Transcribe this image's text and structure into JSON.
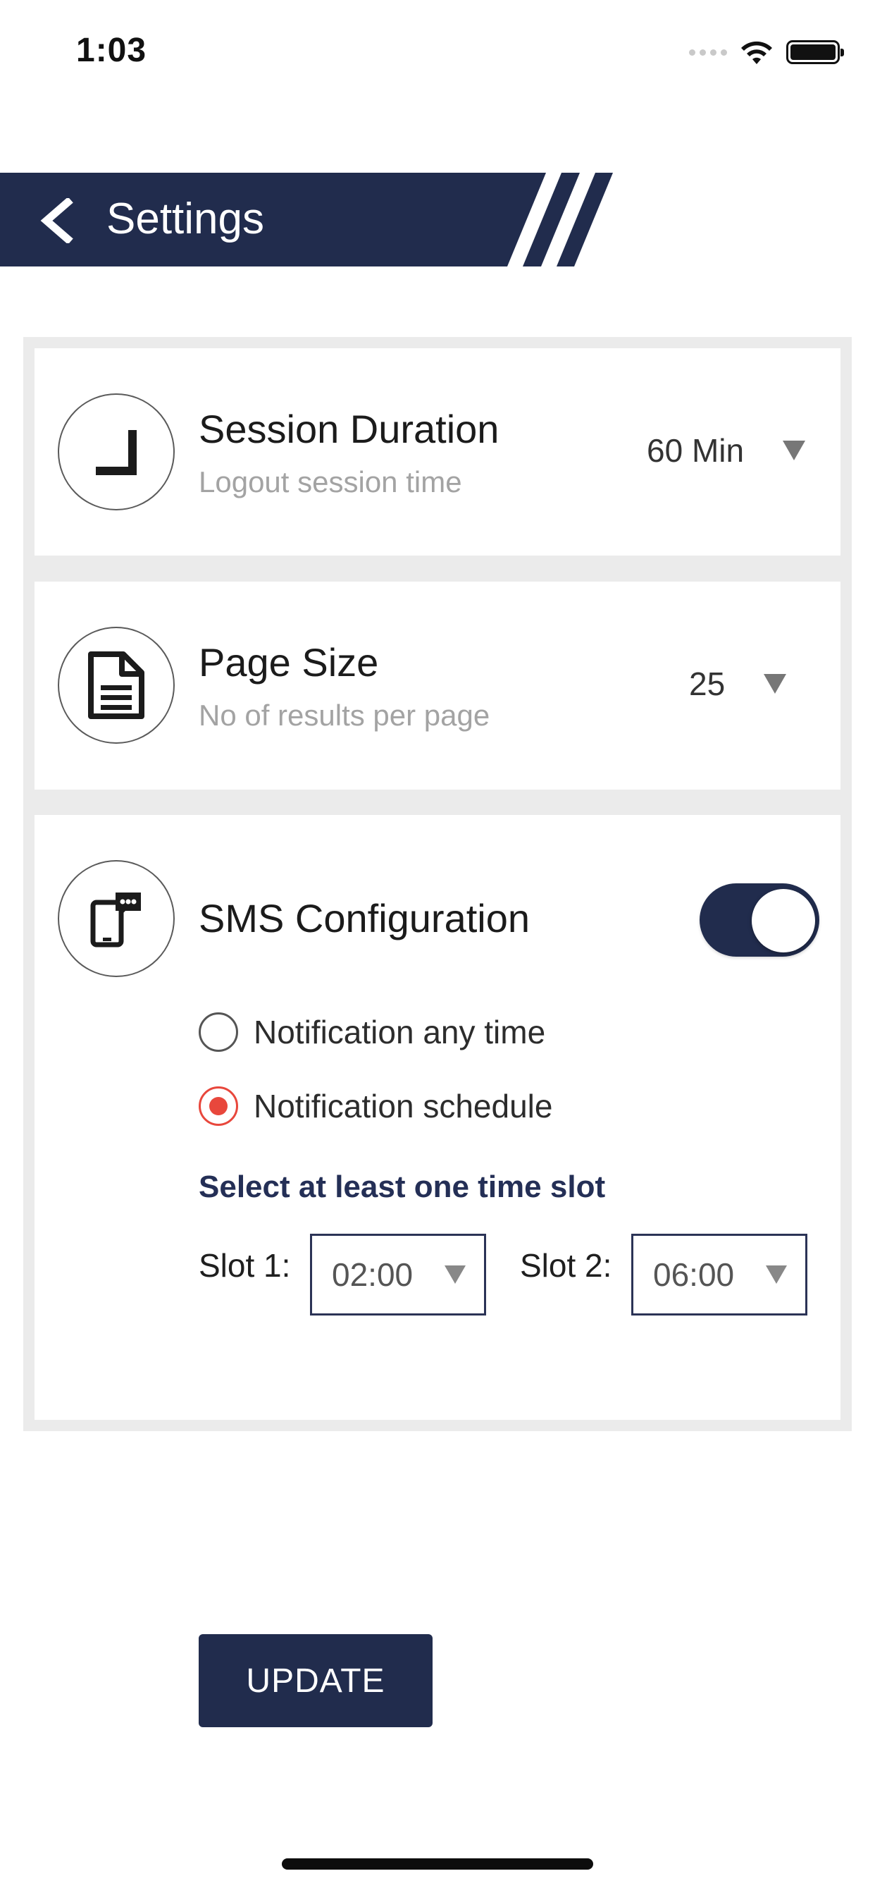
{
  "status_bar": {
    "time": "1:03"
  },
  "header": {
    "title": "Settings",
    "background": "#212c4d"
  },
  "settings": {
    "session": {
      "title": "Session Duration",
      "subtitle": "Logout session time",
      "value": "60 Min"
    },
    "page_size": {
      "title": "Page Size",
      "subtitle": "No of results per page",
      "value": "25"
    },
    "sms": {
      "title": "SMS Configuration",
      "enabled": true,
      "options": [
        {
          "label": "Notification any time",
          "selected": false
        },
        {
          "label": "Notification schedule",
          "selected": true
        }
      ],
      "slot_hint": "Select at least one time slot",
      "slots": [
        {
          "label": "Slot 1:",
          "value": "02:00"
        },
        {
          "label": "Slot 2:",
          "value": "06:00"
        }
      ],
      "update_label": "UPDATE"
    }
  },
  "colors": {
    "primary": "#212c4d",
    "radio_selected": "#e8473c",
    "subtitle": "#a3a3a3",
    "card_border": "#ebebeb"
  },
  "icons": {
    "back": "chevron-left-icon",
    "session": "clock-icon",
    "page_size": "document-icon",
    "sms": "sms-phone-icon"
  }
}
